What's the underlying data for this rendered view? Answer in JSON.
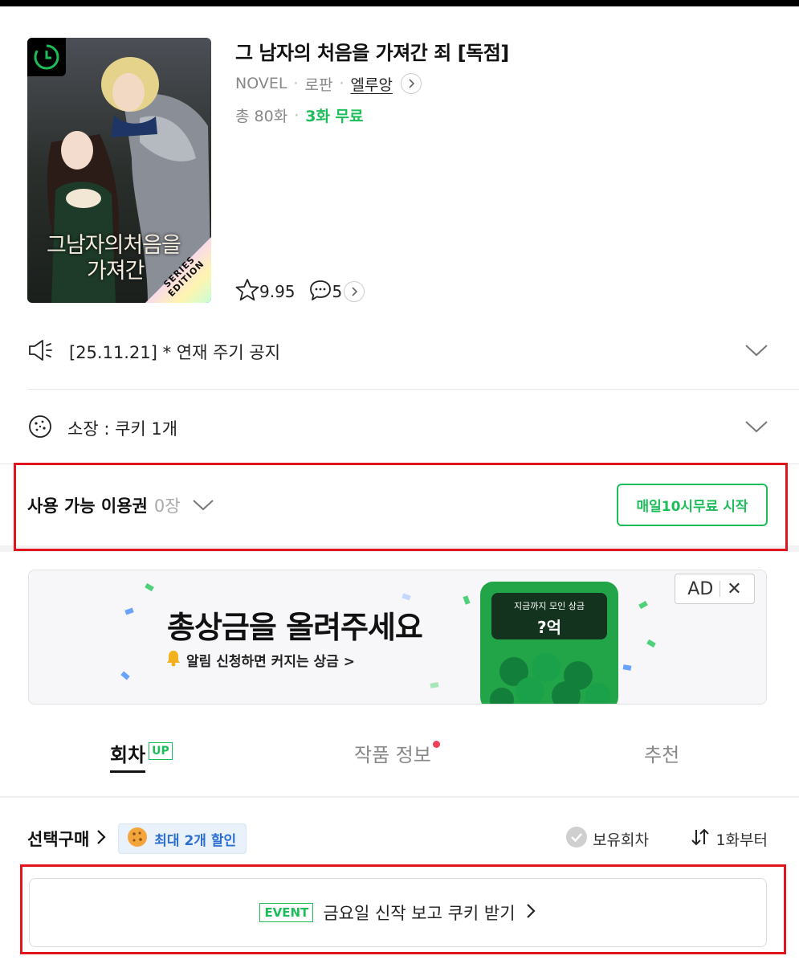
{
  "work": {
    "title": "그 남자의 처음을 가져간 죄 [독점]",
    "category": "NOVEL",
    "genre": "로판",
    "author": "엘루앙",
    "episodes": "총 80화",
    "free_info": "3화 무료",
    "rating": "9.95",
    "comments": "5",
    "cover_title_line1": "그남자의처음을",
    "cover_title_line2": "가져간",
    "cover_badge_line1": "SERIES",
    "cover_badge_line2": "EDITION"
  },
  "notice": {
    "text": "[25.11.21] * 연재 주기 공지"
  },
  "owned_cookies": {
    "text": "소장 : 쿠키 1개"
  },
  "pass": {
    "label": "사용 가능 이용권",
    "count": "0장",
    "button_label": "매일10시무료 시작"
  },
  "ad": {
    "headline": "총상금을 올려주세요",
    "subline": "알림 신청하면 커지는 상금 >",
    "screen_line1": "지금까지 모인 상금",
    "screen_line2": "?억",
    "badge_label": "AD",
    "close_label": "✕"
  },
  "tabs": [
    {
      "label": "회차",
      "badge": "UP"
    },
    {
      "label": "작품 정보"
    },
    {
      "label": "추천"
    }
  ],
  "select_purchase": {
    "label": "선택구매",
    "discount_label": "최대 2개 할인",
    "owned_label": "보유회차",
    "order_label": "1화부터"
  },
  "event": {
    "tag": "EVENT",
    "text": "금요일 신작 보고 쿠키 받기"
  },
  "colors": {
    "accent_green": "#1dbe5a",
    "highlight_red": "#e0141e",
    "discount_blue": "#2c6fd1"
  }
}
